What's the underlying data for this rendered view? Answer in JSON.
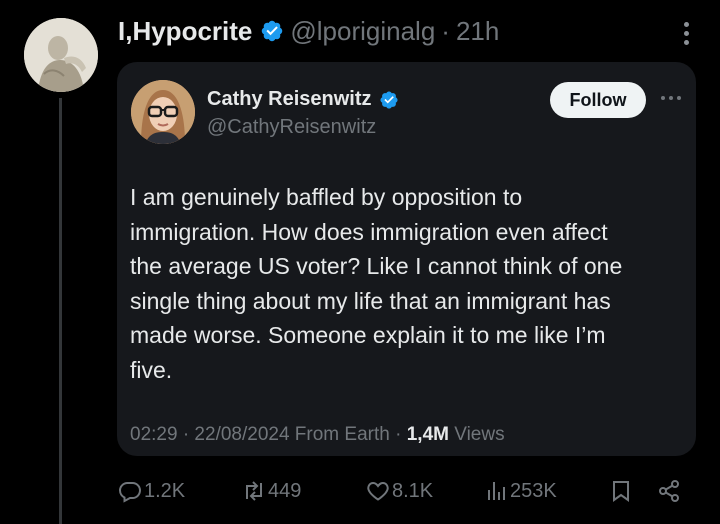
{
  "post": {
    "author_name": "I,Hypocrite",
    "handle": "@lporiginalg",
    "separator": "·",
    "time": "21h"
  },
  "quoted": {
    "author_name": "Cathy Reisenwitz",
    "handle": "@CathyReisenwitz",
    "follow_label": "Follow",
    "text": "I am genuinely baffled by opposition to\nimmigration. How does immigration even affect\nthe average US voter? Like I cannot think of one\nsingle thing about my life that an immigrant has\nmade worse. Someone explain it to me like I’m\nfive.",
    "timestamp": "02:29 · 22/08/2024 From Earth ·",
    "views_count": "1,4M",
    "views_label": "Views"
  },
  "actions": {
    "replies": "1.2K",
    "reposts": "449",
    "likes": "8.1K",
    "views": "253K"
  },
  "colors": {
    "background": "#000000",
    "card": "#16181c",
    "verified": "#1d9bf0",
    "muted": "#71767b",
    "text": "#e7e9ea"
  },
  "icons": [
    "statue-avatar",
    "verified-badge-icon",
    "more-vertical-icon",
    "more-horizontal-icon",
    "reply-icon",
    "repost-icon",
    "like-icon",
    "views-icon",
    "bookmark-icon",
    "share-icon"
  ]
}
